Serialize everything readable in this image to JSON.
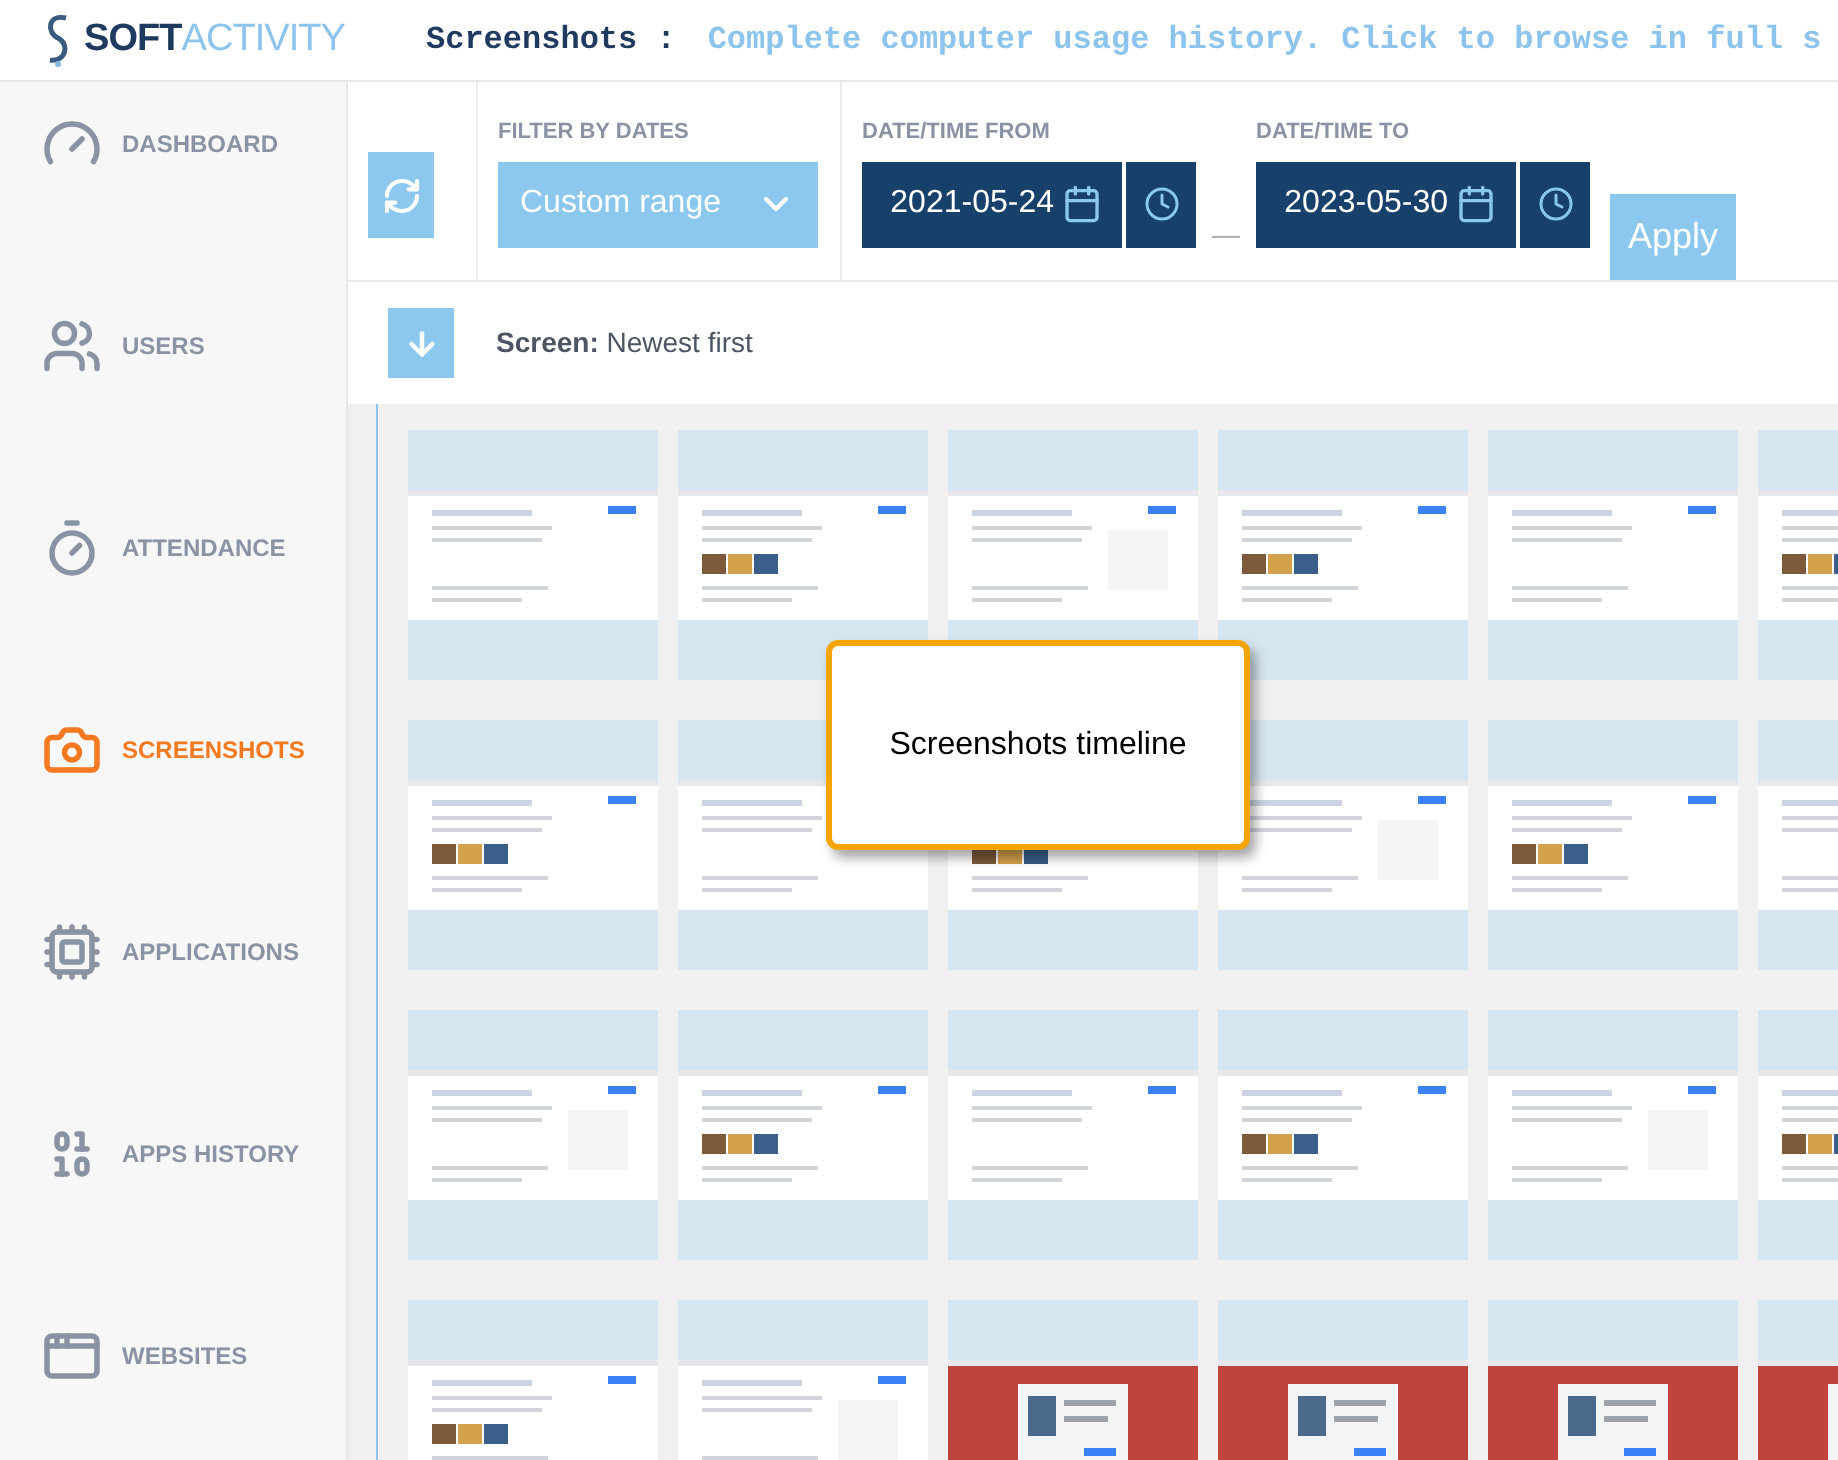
{
  "header": {
    "logo_a": "SOFT",
    "logo_b": "ACTIVITY",
    "title": "Screenshots :",
    "subtitle": "Complete computer usage history. Click to browse in full s"
  },
  "sidebar": {
    "items": [
      {
        "label": "DASHBOARD",
        "selected": false
      },
      {
        "label": "USERS",
        "selected": false
      },
      {
        "label": "ATTENDANCE",
        "selected": false
      },
      {
        "label": "SCREENSHOTS",
        "selected": true
      },
      {
        "label": "APPLICATIONS",
        "selected": false
      },
      {
        "label": "APPS HISTORY",
        "selected": false
      },
      {
        "label": "WEBSITES",
        "selected": false
      }
    ]
  },
  "filters": {
    "filter_label": "FILTER BY DATES",
    "range": "Custom range",
    "from_label": "DATE/TIME FROM",
    "from": "2021-05-24",
    "to_label": "DATE/TIME TO",
    "to": "2023-05-30",
    "separator": "—",
    "apply": "Apply"
  },
  "sort": {
    "label": "Screen:",
    "value": "Newest first"
  },
  "callout": {
    "text": "Screenshots timeline"
  }
}
